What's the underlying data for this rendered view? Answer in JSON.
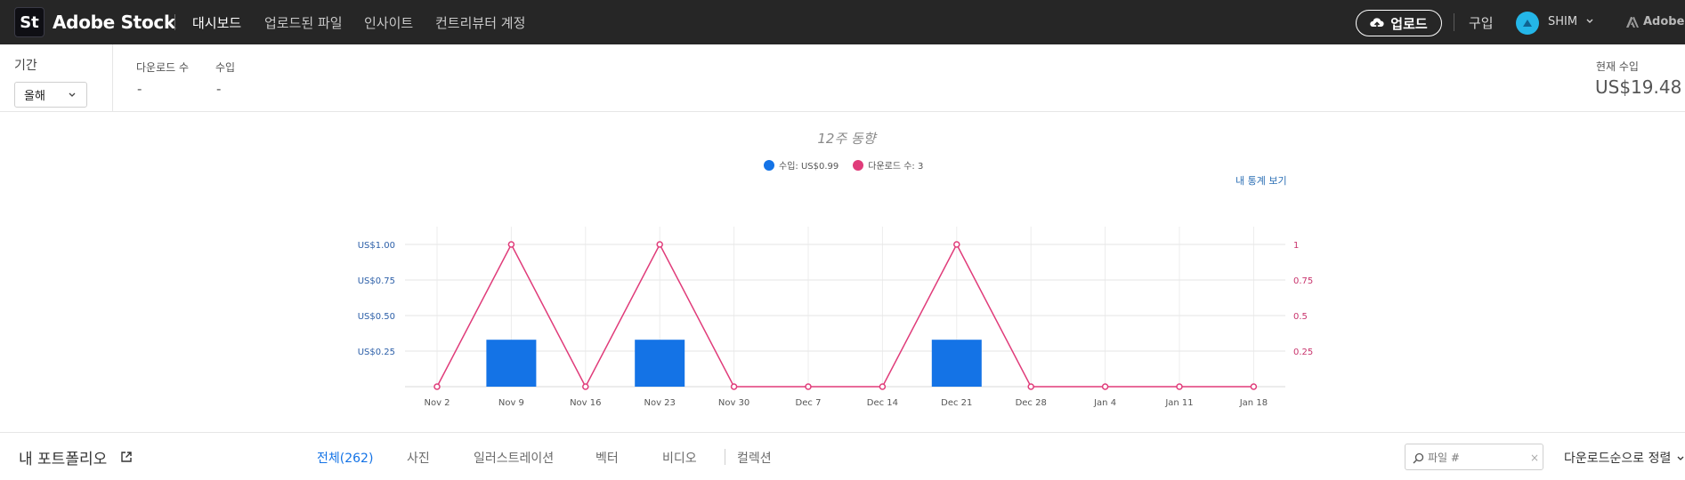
{
  "header": {
    "logo_text": "St",
    "brand": "Adobe Stock",
    "nav": [
      "대시보드",
      "업로드된 파일",
      "인사이트",
      "컨트리뷰터 계정"
    ],
    "upload_label": "업로드",
    "buy_label": "구입",
    "user_name": "SHIM",
    "adobe_label": "Adobe"
  },
  "stats": {
    "period_label": "기간",
    "period_value": "올해",
    "downloads_label": "다운로드 수",
    "downloads_value": "-",
    "revenue_label": "수입",
    "revenue_value": "-",
    "current_label": "현재 수입",
    "current_value": "US$19.48"
  },
  "chart_panel": {
    "title": "12주 동향",
    "legend_revenue": "수입: US$0.99",
    "legend_downloads": "다운로드 수: 3",
    "stats_link": "내 통계 보기"
  },
  "chart_data": {
    "type": "bar",
    "title": "12주 동향",
    "categories": [
      "Nov 2",
      "Nov 9",
      "Nov 16",
      "Nov 23",
      "Nov 30",
      "Dec 7",
      "Dec 14",
      "Dec 21",
      "Dec 28",
      "Jan 4",
      "Jan 11",
      "Jan 18"
    ],
    "series": [
      {
        "name": "수입: US$0.99",
        "type": "bar",
        "axis": "left",
        "values": [
          0,
          0.33,
          0,
          0.33,
          0,
          0,
          0,
          0.33,
          0,
          0,
          0,
          0
        ]
      },
      {
        "name": "다운로드 수: 3",
        "type": "line",
        "axis": "right",
        "values": [
          0,
          1,
          0,
          1,
          0,
          0,
          0,
          1,
          0,
          0,
          0,
          0
        ]
      }
    ],
    "left_ticks": [
      "US$0.25",
      "US$0.50",
      "US$0.75",
      "US$1.00"
    ],
    "left_tick_values": [
      0.25,
      0.5,
      0.75,
      1.0
    ],
    "right_ticks": [
      "0.25",
      "0.5",
      "0.75",
      "1"
    ],
    "right_tick_values": [
      0.25,
      0.5,
      0.75,
      1
    ],
    "ylim": [
      0,
      1.0
    ],
    "grid": true,
    "legend_position": "top-center",
    "colors": {
      "bar": "#1473e6",
      "line": "#e03c7a",
      "left_axis": "#2c5fa8",
      "right_axis": "#c8336c"
    }
  },
  "portfolio": {
    "title": "내 포트폴리오",
    "tabs": [
      "전체(262)",
      "사진",
      "일러스트레이션",
      "벡터",
      "비디오",
      "컬렉션"
    ],
    "search_placeholder": "파일 #",
    "search_clear": "×",
    "sort_label": "다운로드순으로 정렬"
  }
}
